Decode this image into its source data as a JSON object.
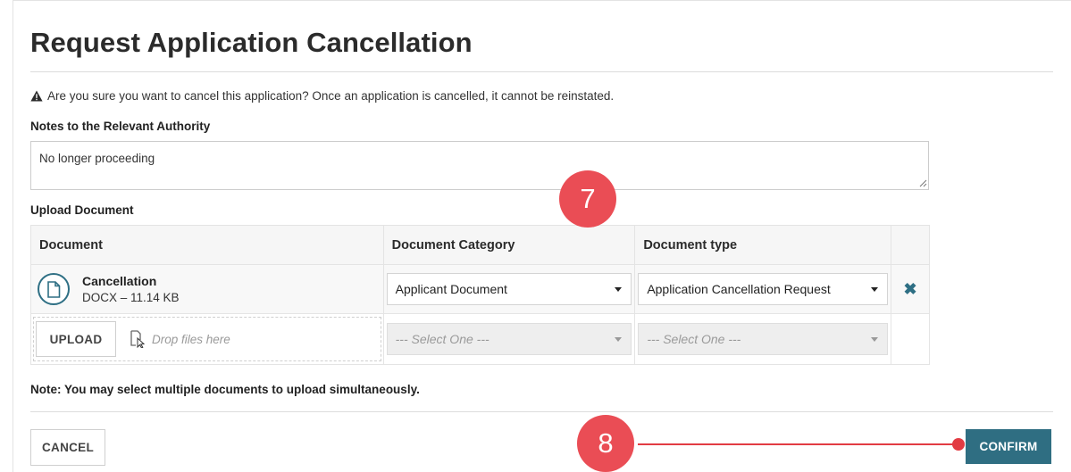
{
  "dialog": {
    "title": "Request Application Cancellation",
    "warning": "Are you sure you want to cancel this application? Once an application is cancelled, it cannot be reinstated.",
    "notes_label": "Notes to the Relevant Authority",
    "notes_value": "No longer proceeding",
    "upload_label": "Upload Document",
    "table": {
      "headers": [
        "Document",
        "Document Category",
        "Document type"
      ],
      "document": {
        "name": "Cancellation",
        "meta": "DOCX – 11.14 KB",
        "category": "Applicant Document",
        "type": "Application Cancellation Request"
      },
      "upload_row": {
        "upload_label": "UPLOAD",
        "drop_text": "Drop files here",
        "category_placeholder": "--- Select One ---",
        "type_placeholder": "--- Select One ---"
      }
    },
    "note": "Note: You may select multiple documents to upload simultaneously.",
    "cancel_label": "CANCEL",
    "confirm_label": "CONFIRM"
  },
  "annotations": {
    "marker7": "7",
    "marker8": "8"
  },
  "colors": {
    "accent": "#2f6e82",
    "marker": "#ea4d55",
    "connector": "#e23b43"
  },
  "icons": [
    "warning-icon",
    "document-icon",
    "drop-cursor-icon",
    "remove-icon",
    "dropdown-caret-icon"
  ]
}
